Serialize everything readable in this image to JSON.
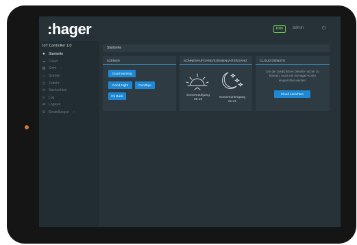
{
  "app": {
    "logo": ":hager",
    "user": "admin",
    "knx_badge": "KNX"
  },
  "sidebar": {
    "title": "IoT Controller 1.0",
    "items": [
      {
        "label": "Startseite",
        "icon": "star-icon",
        "glyph": "★",
        "active": true,
        "chevron": false
      },
      {
        "label": "Cloud",
        "icon": "cloud-icon",
        "glyph": "☁",
        "active": false,
        "chevron": false
      },
      {
        "label": "Sicht",
        "icon": "grid-icon",
        "glyph": "▦",
        "active": false,
        "chevron": true
      },
      {
        "label": "Szenen",
        "icon": "scenes-icon",
        "glyph": "▭",
        "active": false,
        "chevron": false
      },
      {
        "label": "Zeituhr",
        "icon": "clock-icon",
        "glyph": "◷",
        "active": false,
        "chevron": false
      },
      {
        "label": "Nachrichten",
        "icon": "message-icon",
        "glyph": "✉",
        "active": false,
        "chevron": false
      },
      {
        "label": "Log",
        "icon": "list-icon",
        "glyph": "≡",
        "active": false,
        "chevron": false
      },
      {
        "label": "Logiken",
        "icon": "logic-icon",
        "glyph": "⇄",
        "active": false,
        "chevron": false
      },
      {
        "label": "Einstellungen",
        "icon": "settings-icon",
        "glyph": "⚙",
        "active": false,
        "chevron": true
      }
    ]
  },
  "breadcrumb": "Startseite",
  "panels": {
    "scenes": {
      "title": "SZENEN",
      "buttons": [
        "Good Morning",
        "Good Night",
        "Goodbye",
        "I'm Back"
      ]
    },
    "sun": {
      "title": "SONNENAUFGANG/SONNENUNTERGANG",
      "sunrise_label": "Sonnenaufgang",
      "sunrise_time": "05:16",
      "sunset_label": "Sonnenuntergang",
      "sunset_time": "21:41"
    },
    "cloud": {
      "title": "CLOUD DIENSTE",
      "text": "Um die zusätzlichen Dienste nutzen zu können, muss ein myHager-Konto eingerichtet werden.",
      "button": "Cloud einrichten"
    }
  },
  "colors": {
    "accent": "#1e88d4",
    "background": "#263238",
    "sidebar": "#222d32",
    "knx": "#6fbf55"
  }
}
